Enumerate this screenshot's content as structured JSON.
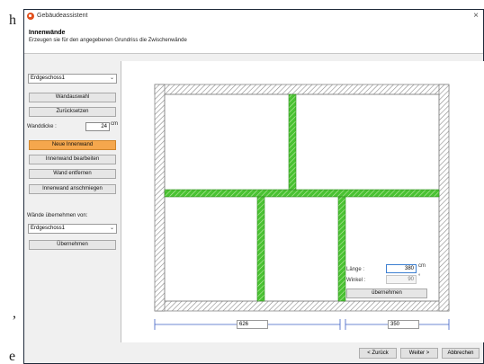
{
  "background": {
    "glyph_1": "h",
    "glyph_2": ",",
    "glyph_3": "e"
  },
  "window": {
    "title": "Gebäudeassistent",
    "close_glyph": "×"
  },
  "header": {
    "title": "Innenwände",
    "subtitle": "Erzeugen sie für den angegebenen Grundriss die Zwischenwände"
  },
  "left_panel": {
    "floor_select": "Erdgeschoss1",
    "btn_wandauswahl": "Wandauswahl",
    "btn_zuruecksetzen": "Zurücksetzen",
    "wanddicke_label": "Wanddicke :",
    "wanddicke_value": "24",
    "wanddicke_unit": "cm",
    "btn_neue_innenwand": "Neue Innenwand",
    "btn_innenwand_bearbeiten": "Innenwand bearbeiten",
    "btn_wand_entfernen": "Wand entfernen",
    "btn_innenwand_anschmiegen": "Innenwand anschmiegen",
    "uebernehmen_label": "Wände übernehmen von:",
    "source_select": "Erdgeschoss1",
    "btn_uebernehmen": "Übernehmen",
    "dropdown_glyph": "⌄"
  },
  "canvas": {
    "wall_props": {
      "laenge_label": "Länge :",
      "laenge_value": "380",
      "laenge_unit": "cm",
      "winkel_label": "Winkel :",
      "winkel_value": "90",
      "winkel_unit": "°",
      "apply_button": "übernehmen"
    },
    "dimensions": {
      "left": "626",
      "right": "350"
    }
  },
  "footer": {
    "back": "< Zurück",
    "next": "Weiter >",
    "cancel": "Abbrechen"
  },
  "colors": {
    "wall_green": "#49c232",
    "active_button": "#f5a74d",
    "dimension_blue": "#3d5fc4"
  }
}
